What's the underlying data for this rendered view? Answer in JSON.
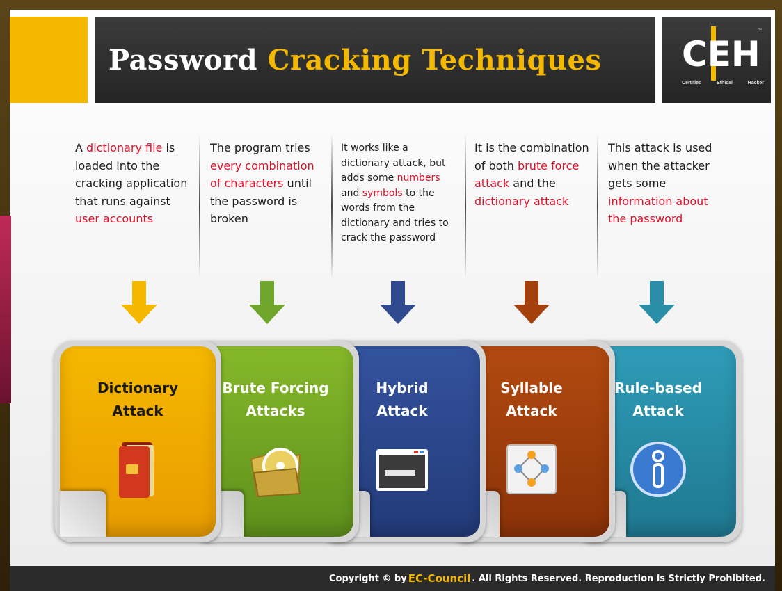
{
  "header": {
    "title_part1": "Password",
    "title_part2": "Cracking Techniques",
    "logo": {
      "letters": [
        "C",
        "E",
        "H"
      ],
      "sub": [
        "Certified",
        "Ethical",
        "Hacker"
      ],
      "tm": "™"
    }
  },
  "columns": [
    {
      "segments": [
        {
          "t": "A ",
          "red": false
        },
        {
          "t": "dictionary file",
          "red": true
        },
        {
          "t": " is loaded into the cracking application that runs against ",
          "red": false
        },
        {
          "t": "user accounts",
          "red": true
        }
      ],
      "arrow_color": "#f5b800",
      "card_title": [
        "Dictionary",
        "Attack"
      ],
      "card_color": "#f5b800",
      "card_color2": "#e89c00",
      "title_dark": true,
      "icon": "book-icon"
    },
    {
      "segments": [
        {
          "t": "The program tries ",
          "red": false
        },
        {
          "t": "every combination of characters",
          "red": true
        },
        {
          "t": " until the password is broken",
          "red": false
        }
      ],
      "arrow_color": "#6fa52a",
      "card_title": [
        "Brute Forcing",
        "Attacks"
      ],
      "card_color": "#86b82a",
      "card_color2": "#5e8f1c",
      "title_dark": false,
      "icon": "disc-folder-icon"
    },
    {
      "segments": [
        {
          "t": "It works like a dictionary attack, but adds some ",
          "red": false
        },
        {
          "t": "numbers",
          "red": true
        },
        {
          "t": " and ",
          "red": false
        },
        {
          "t": "symbols",
          "red": true
        },
        {
          "t": " to the words from the dictionary and tries to crack the password",
          "red": false
        }
      ],
      "small": true,
      "arrow_color": "#2f4a8e",
      "card_title": [
        "Hybrid",
        "Attack"
      ],
      "card_color": "#34539e",
      "card_color2": "#223a78",
      "title_dark": false,
      "icon": "terminal-window-icon"
    },
    {
      "segments": [
        {
          "t": "It is the combination of both ",
          "red": false
        },
        {
          "t": "brute force attack",
          "red": true
        },
        {
          "t": " and the ",
          "red": false
        },
        {
          "t": "dictionary attack",
          "red": true
        }
      ],
      "arrow_color": "#a3400c",
      "card_title": [
        "Syllable",
        "Attack"
      ],
      "card_color": "#b24a10",
      "card_color2": "#8a3208",
      "title_dark": false,
      "icon": "diagram-nodes-icon"
    },
    {
      "segments": [
        {
          "t": "This attack is used when the attacker gets some ",
          "red": false
        },
        {
          "t": "information about the password",
          "red": true
        }
      ],
      "arrow_color": "#2a8ea8",
      "card_title": [
        "Rule-based",
        "Attack"
      ],
      "card_color": "#2f9cb8",
      "card_color2": "#1f7890",
      "title_dark": false,
      "icon": "info-icon"
    }
  ],
  "footer": {
    "prefix": "Copyright © by",
    "brand": "EC-Council",
    "suffix": ". All Rights Reserved. Reproduction is Strictly Prohibited."
  }
}
